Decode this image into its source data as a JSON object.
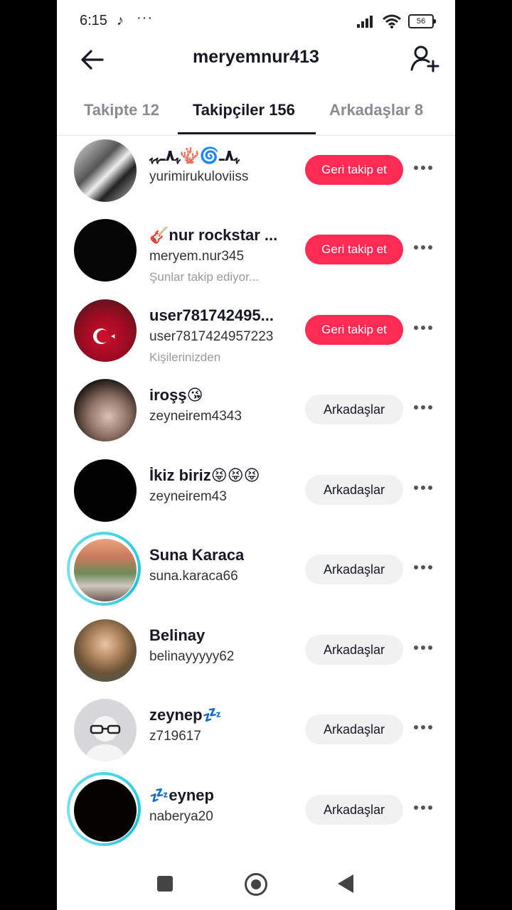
{
  "status_bar": {
    "time": "6:15",
    "battery": "56"
  },
  "header": {
    "title": "meryemnur413"
  },
  "tabs": [
    {
      "label": "Takipte 12",
      "active": false
    },
    {
      "label": "Takipçiler 156",
      "active": true
    },
    {
      "label": "Arkadaşlar 8",
      "active": false
    }
  ],
  "rows": [
    {
      "name": "ﮩ٨ـ🌀🪸ﮩ٨ـﮩﮩ",
      "username": "yurimirukuloviiss",
      "sub": "",
      "button": "Geri takip et",
      "button_type": "follow"
    },
    {
      "name": "🎸nur rockstar ...",
      "username": "meryem.nur345",
      "sub": "Şunlar takip ediyor...",
      "button": "Geri takip et",
      "button_type": "follow"
    },
    {
      "name": "user781742495...",
      "username": "user7817424957223",
      "sub": "Kişilerinizden",
      "button": "Geri takip et",
      "button_type": "follow"
    },
    {
      "name": "iroşş😘",
      "username": "zeyneirem4343",
      "sub": "",
      "button": "Arkadaşlar",
      "button_type": "friends"
    },
    {
      "name": "İkiz biriz😝😝😝",
      "username": "zeyneirem43",
      "sub": "",
      "button": "Arkadaşlar",
      "button_type": "friends"
    },
    {
      "name": "Suna Karaca",
      "username": "suna.karaca66",
      "sub": "",
      "button": "Arkadaşlar",
      "button_type": "friends"
    },
    {
      "name": "Belinay",
      "username": "belinayyyyy62",
      "sub": "",
      "button": "Arkadaşlar",
      "button_type": "friends"
    },
    {
      "name": "zeynep💤",
      "username": "z719617",
      "sub": "",
      "button": "Arkadaşlar",
      "button_type": "friends"
    },
    {
      "name": "💤eynep",
      "username": "naberya20",
      "sub": "",
      "button": "Arkadaşlar",
      "button_type": "friends"
    }
  ],
  "colors": {
    "accent": "#fe2c55",
    "story_ring": "#4fd6e8"
  },
  "icons": {
    "back": "arrow-left-icon",
    "add_friend": "person-plus-icon",
    "more": "more-horizontal-icon"
  }
}
